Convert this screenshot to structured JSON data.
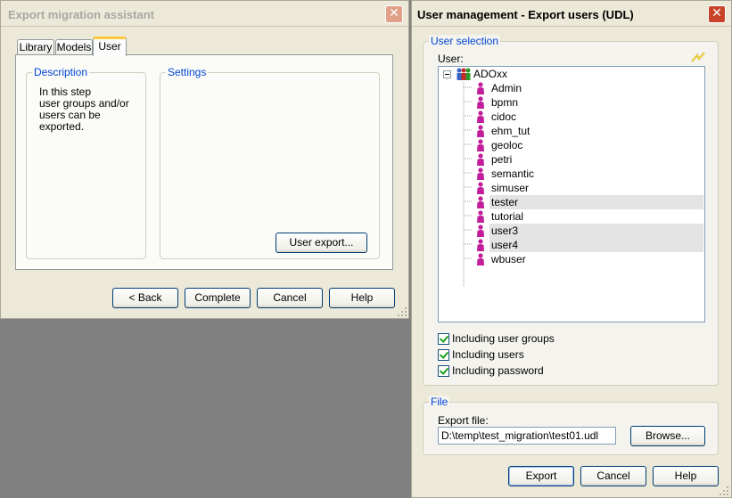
{
  "left_window": {
    "title": "Export migration assistant",
    "tabs": [
      {
        "label": "Library",
        "selected": false
      },
      {
        "label": "Models",
        "selected": false
      },
      {
        "label": "User",
        "selected": true
      }
    ],
    "description": {
      "legend": "Description",
      "lines": [
        "In this step",
        "user groups and/or",
        "users can be",
        "exported."
      ]
    },
    "settings": {
      "legend": "Settings",
      "user_export_button": "User export..."
    },
    "buttons": {
      "back": "< Back",
      "complete": "Complete",
      "cancel": "Cancel",
      "help": "Help"
    }
  },
  "right_window": {
    "title": "User management - Export users (UDL)",
    "user_selection": {
      "legend": "User selection",
      "user_label": "User:",
      "root": "ADOxx",
      "users": [
        {
          "name": "Admin",
          "highlighted": false
        },
        {
          "name": "bpmn",
          "highlighted": false
        },
        {
          "name": "cidoc",
          "highlighted": false
        },
        {
          "name": "ehm_tut",
          "highlighted": false
        },
        {
          "name": "geoloc",
          "highlighted": false
        },
        {
          "name": "petri",
          "highlighted": false
        },
        {
          "name": "semantic",
          "highlighted": false
        },
        {
          "name": "simuser",
          "highlighted": false
        },
        {
          "name": "tester",
          "highlighted": true
        },
        {
          "name": "tutorial",
          "highlighted": false
        },
        {
          "name": "user3",
          "highlighted": true
        },
        {
          "name": "user4",
          "highlighted": true
        },
        {
          "name": "wbuser",
          "highlighted": false
        }
      ],
      "options": [
        {
          "label": "Including user groups",
          "checked": true
        },
        {
          "label": "Including users",
          "checked": true
        },
        {
          "label": "Including password",
          "checked": true
        }
      ]
    },
    "file": {
      "legend": "File",
      "export_file_label": "Export file:",
      "export_file_value": "D:\\temp\\test_migration\\test01.udl",
      "browse_button": "Browse..."
    },
    "buttons": {
      "export": "Export",
      "cancel": "Cancel",
      "help": "Help"
    }
  },
  "colors": {
    "accent": "#0046d5",
    "user_icon": "#c21e9b",
    "close_button": "#c8432a",
    "check": "#21a121"
  },
  "icons": {
    "tree_root": "user-group-icon",
    "tree_item": "user-icon",
    "refresh": "lightning-icon"
  }
}
